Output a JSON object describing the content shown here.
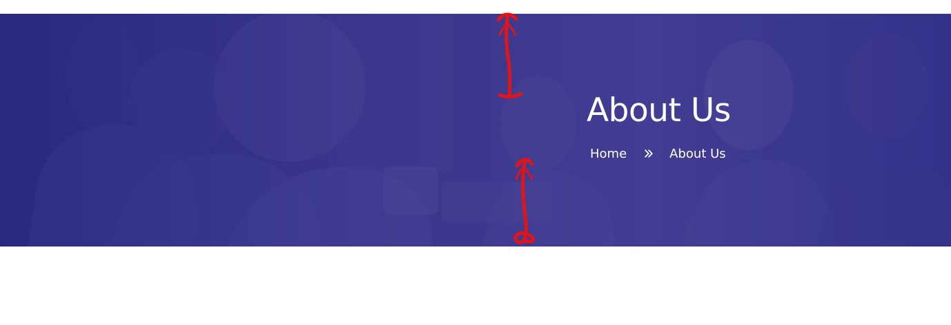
{
  "banner": {
    "title": "About Us",
    "breadcrumb": {
      "home_label": "Home",
      "separator_icon": "double-chevron-right-icon",
      "current_label": "About Us"
    }
  },
  "annotations": {
    "arrow_color": "#e1141a"
  },
  "colors": {
    "banner_overlay": "#2f2d85",
    "text": "#ffffff",
    "page_background": "#ffffff"
  }
}
